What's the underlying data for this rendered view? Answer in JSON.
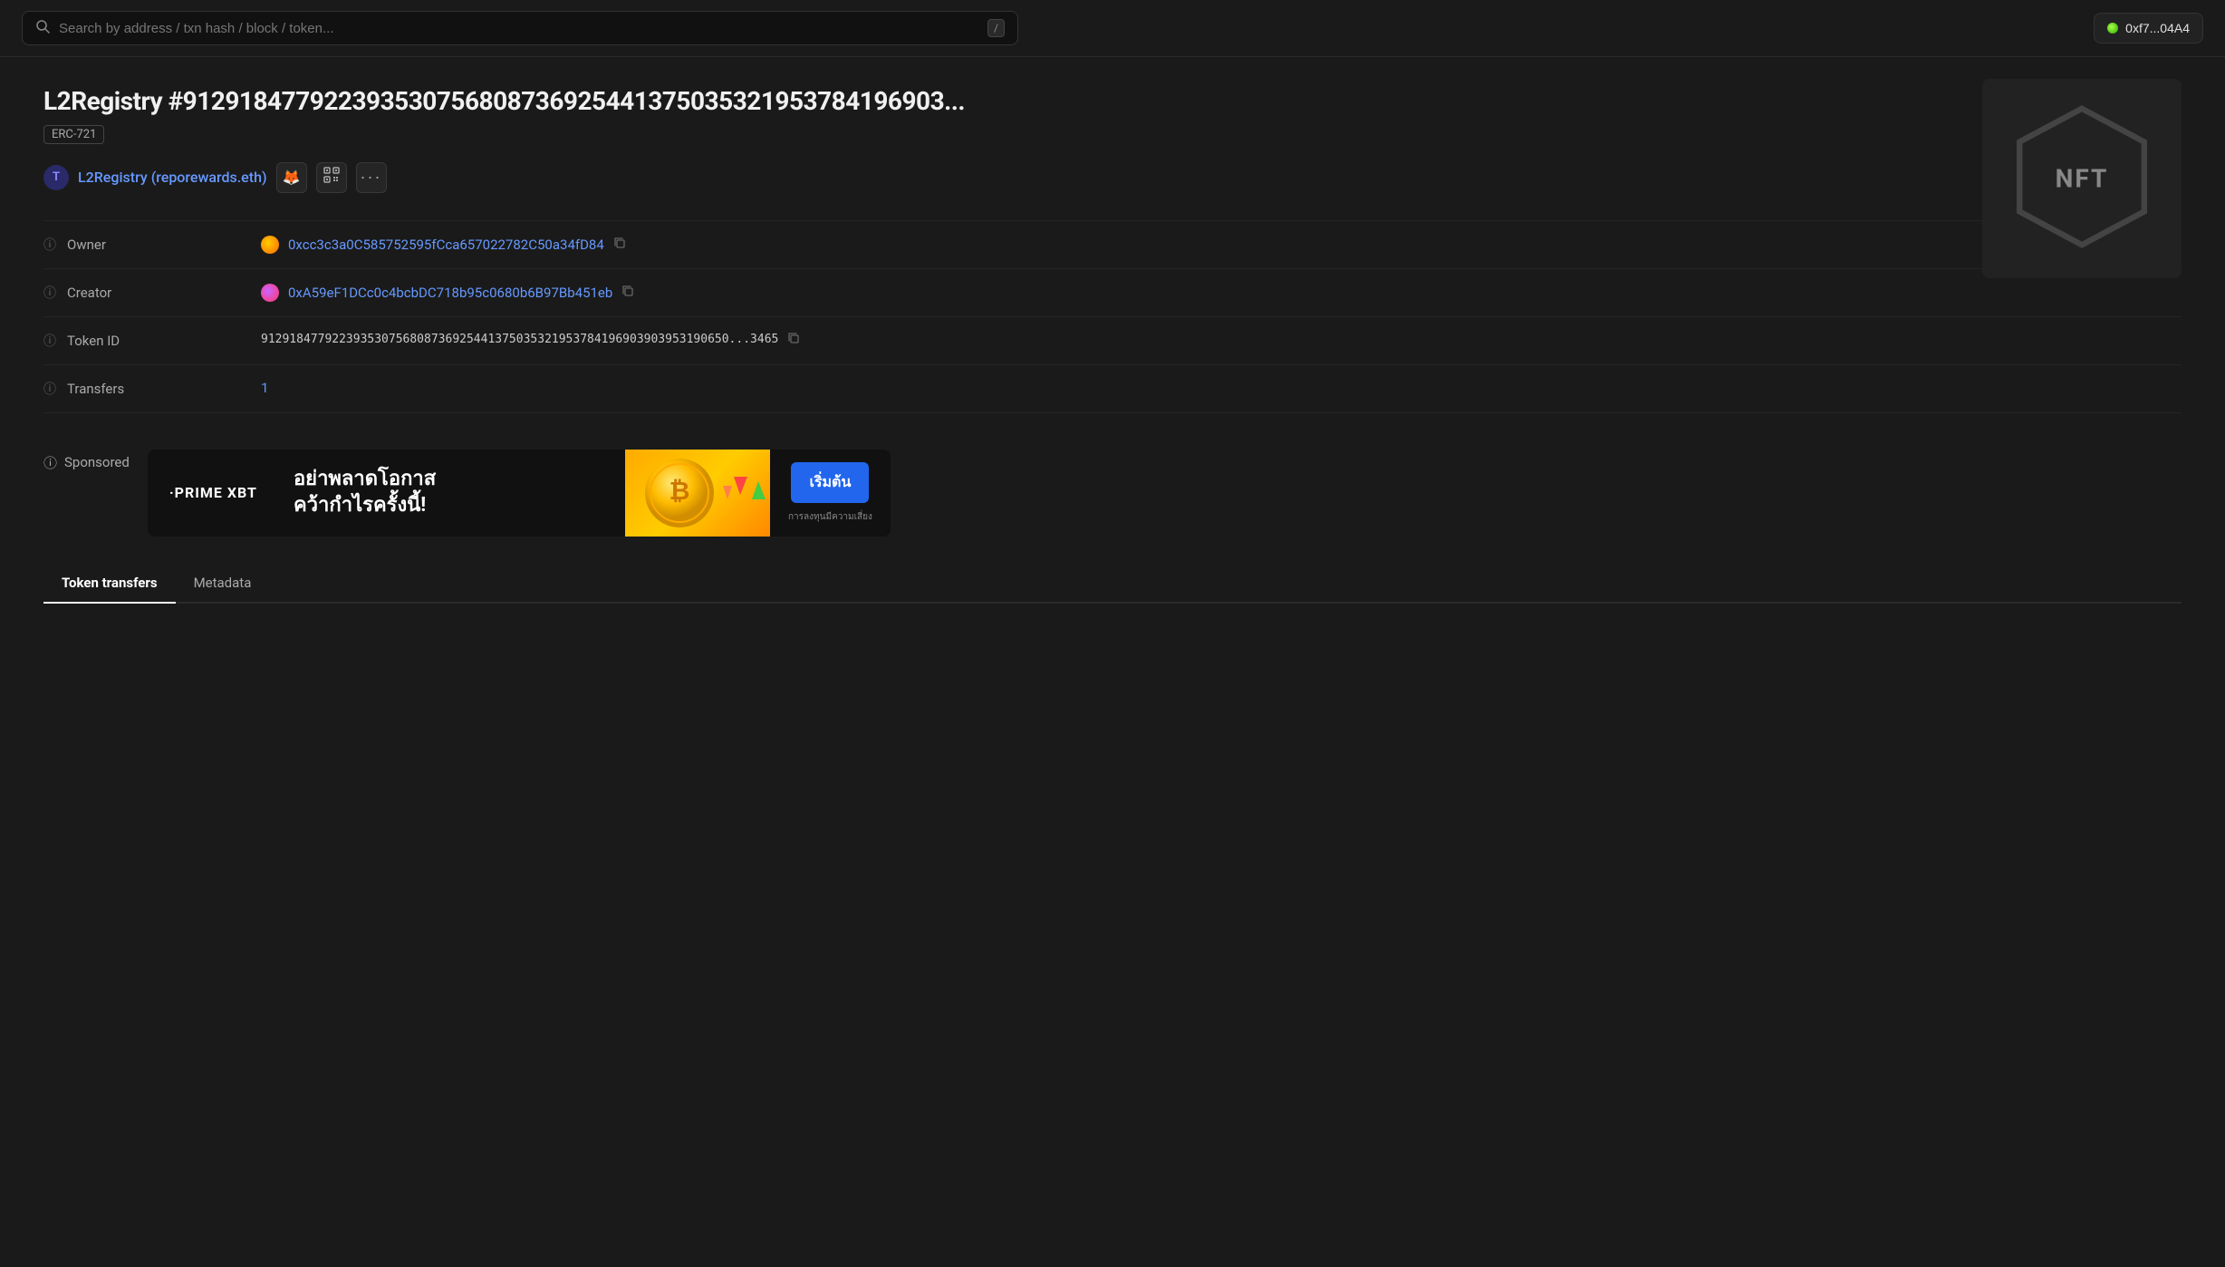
{
  "topbar": {
    "search_placeholder": "Search by address / txn hash / block / token...",
    "slash_label": "/",
    "wallet_address": "0xf7...04A4"
  },
  "page": {
    "title": "L2Registry #91291847792239353075680873692544137503532195378419690...",
    "title_full": "L2Registry #912918477922393530756808736925441375035321953784196903...",
    "token_standard": "ERC-721"
  },
  "contract": {
    "t_label": "T",
    "name": "L2Registry (reporewards.eth)",
    "metamask_icon": "🦊",
    "qr_icon": "▦",
    "more_icon": "..."
  },
  "fields": {
    "owner_label": "Owner",
    "owner_address": "0xcc3c3a0C585752595fCca657022782C50a34fD84",
    "creator_label": "Creator",
    "creator_address": "0xA59eF1DCc0c4bcbDC718b95c0680b6B97Bb451eb",
    "token_id_label": "Token ID",
    "token_id_value": "912918477922393530756808736925441375035321953784196903903953190650...3465",
    "transfers_label": "Transfers",
    "transfers_value": "1"
  },
  "nft": {
    "hex_text": "NFT"
  },
  "sponsored": {
    "label": "Sponsored",
    "info_icon": "ⓘ"
  },
  "ad": {
    "brand": "·PRIME XBT",
    "thai_line1": "อย่าพลาดโอกาส",
    "thai_line2": "คว้ากำไรครั้งนี้!",
    "cta_button": "เริ่มต้น",
    "disclaimer": "การลงทุนมีความเสี่ยง"
  },
  "tabs": [
    {
      "label": "Token transfers",
      "active": true
    },
    {
      "label": "Metadata",
      "active": false
    }
  ]
}
